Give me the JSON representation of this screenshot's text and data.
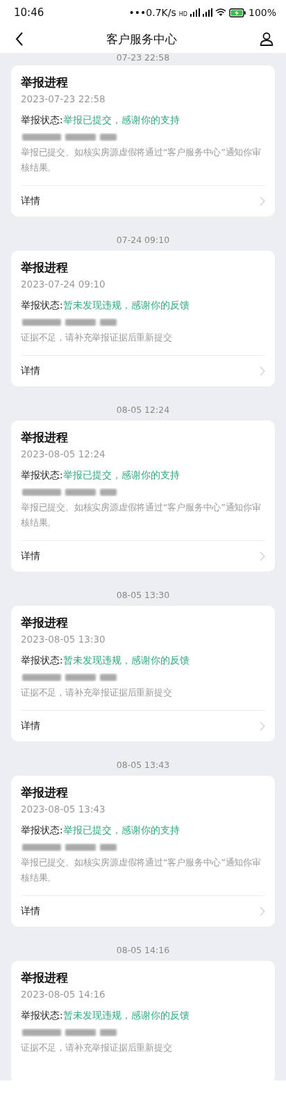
{
  "status_bar": {
    "time": "10:46",
    "dots": "•••",
    "speed": "0.7K/s",
    "hd": "HD",
    "battery": "100%"
  },
  "header": {
    "title": "客户服务中心"
  },
  "records": [
    {
      "date_label": "07-23 22:58",
      "title": "举报进程",
      "time": "2023-07-23 22:58",
      "status_label": "举报状态:",
      "status_value": "举报已提交，感谢你的支持",
      "description": "举报已提交。如核实房源虚假将通过“客户服务中心”通知你审核结果。",
      "detail": "详情"
    },
    {
      "date_label": "07-24 09:10",
      "title": "举报进程",
      "time": "2023-07-24 09:10",
      "status_label": "举报状态:",
      "status_value": "暂未发现违规，感谢你的反馈",
      "description": "证据不足，请补充举报证据后重新提交",
      "detail": "详情"
    },
    {
      "date_label": "08-05 12:24",
      "title": "举报进程",
      "time": "2023-08-05 12:24",
      "status_label": "举报状态:",
      "status_value": "举报已提交，感谢你的支持",
      "description": "举报已提交。如核实房源虚假将通过“客户服务中心”通知你审核结果。",
      "detail": "详情"
    },
    {
      "date_label": "08-05 13:30",
      "title": "举报进程",
      "time": "2023-08-05 13:30",
      "status_label": "举报状态:",
      "status_value": "暂未发现违规，感谢你的反馈",
      "description": "证据不足，请补充举报证据后重新提交",
      "detail": "详情"
    },
    {
      "date_label": "08-05 13:43",
      "title": "举报进程",
      "time": "2023-08-05 13:43",
      "status_label": "举报状态:",
      "status_value": "举报已提交，感谢你的支持",
      "description": "举报已提交。如核实房源虚假将通过“客户服务中心”通知你审核结果。",
      "detail": "详情"
    },
    {
      "date_label": "08-05 14:16",
      "title": "举报进程",
      "time": "2023-08-05 14:16",
      "status_label": "举报状态:",
      "status_value": "暂未发现违规，感谢你的反馈",
      "description": "证据不足，请补充举报证据后重新提交"
    }
  ]
}
